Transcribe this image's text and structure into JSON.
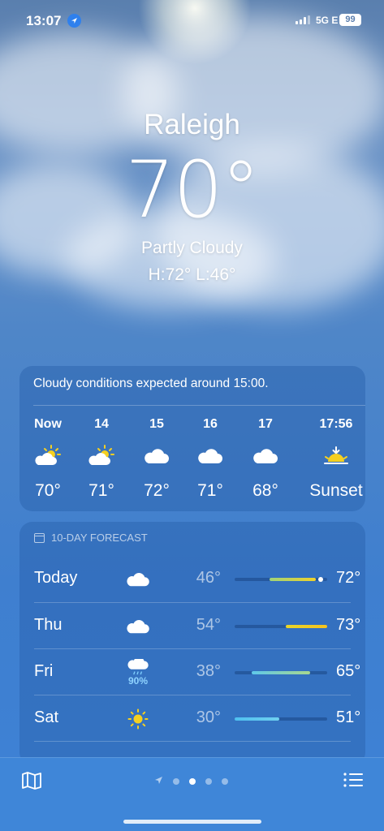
{
  "status_bar": {
    "time": "13:07",
    "network": "5G E",
    "battery": "99"
  },
  "location": {
    "city": "Raleigh",
    "temperature": "70°",
    "condition": "Partly Cloudy",
    "high_low": "H:72°  L:46°"
  },
  "hourly": {
    "summary": "Cloudy conditions expected around 15:00.",
    "items": [
      {
        "label": "Now",
        "icon": "partly-sunny-icon",
        "value": "70°"
      },
      {
        "label": "14",
        "icon": "partly-sunny-icon",
        "value": "71°"
      },
      {
        "label": "15",
        "icon": "cloud-icon",
        "value": "72°"
      },
      {
        "label": "16",
        "icon": "cloud-icon",
        "value": "71°"
      },
      {
        "label": "17",
        "icon": "cloud-icon",
        "value": "68°"
      },
      {
        "label": "17:56",
        "icon": "sunset-icon",
        "value": "Sunset"
      }
    ]
  },
  "daily": {
    "header": "10-DAY FORECAST",
    "rows": [
      {
        "day": "Today",
        "icon": "cloud-icon",
        "precip": "",
        "low": "46°",
        "high": "72°",
        "range_start": 0.38,
        "range_end": 0.88,
        "current": 0.93
      },
      {
        "day": "Thu",
        "icon": "cloud-icon",
        "precip": "",
        "low": "54°",
        "high": "73°",
        "range_start": 0.55,
        "range_end": 1.0
      },
      {
        "day": "Fri",
        "icon": "rain-cloud-icon",
        "precip": "90%",
        "low": "38°",
        "high": "65°",
        "range_start": 0.18,
        "range_end": 0.82
      },
      {
        "day": "Sat",
        "icon": "sun-icon",
        "precip": "",
        "low": "30°",
        "high": "51°",
        "range_start": 0.0,
        "range_end": 0.48
      }
    ]
  },
  "tabbar": {
    "pages": 4,
    "active_page": 1
  },
  "colors": {
    "accent_warm": "#f5d020",
    "accent_green": "#b8d86a",
    "accent_cyan": "#6fd3e6",
    "accent_blue": "#5fc4f0"
  }
}
